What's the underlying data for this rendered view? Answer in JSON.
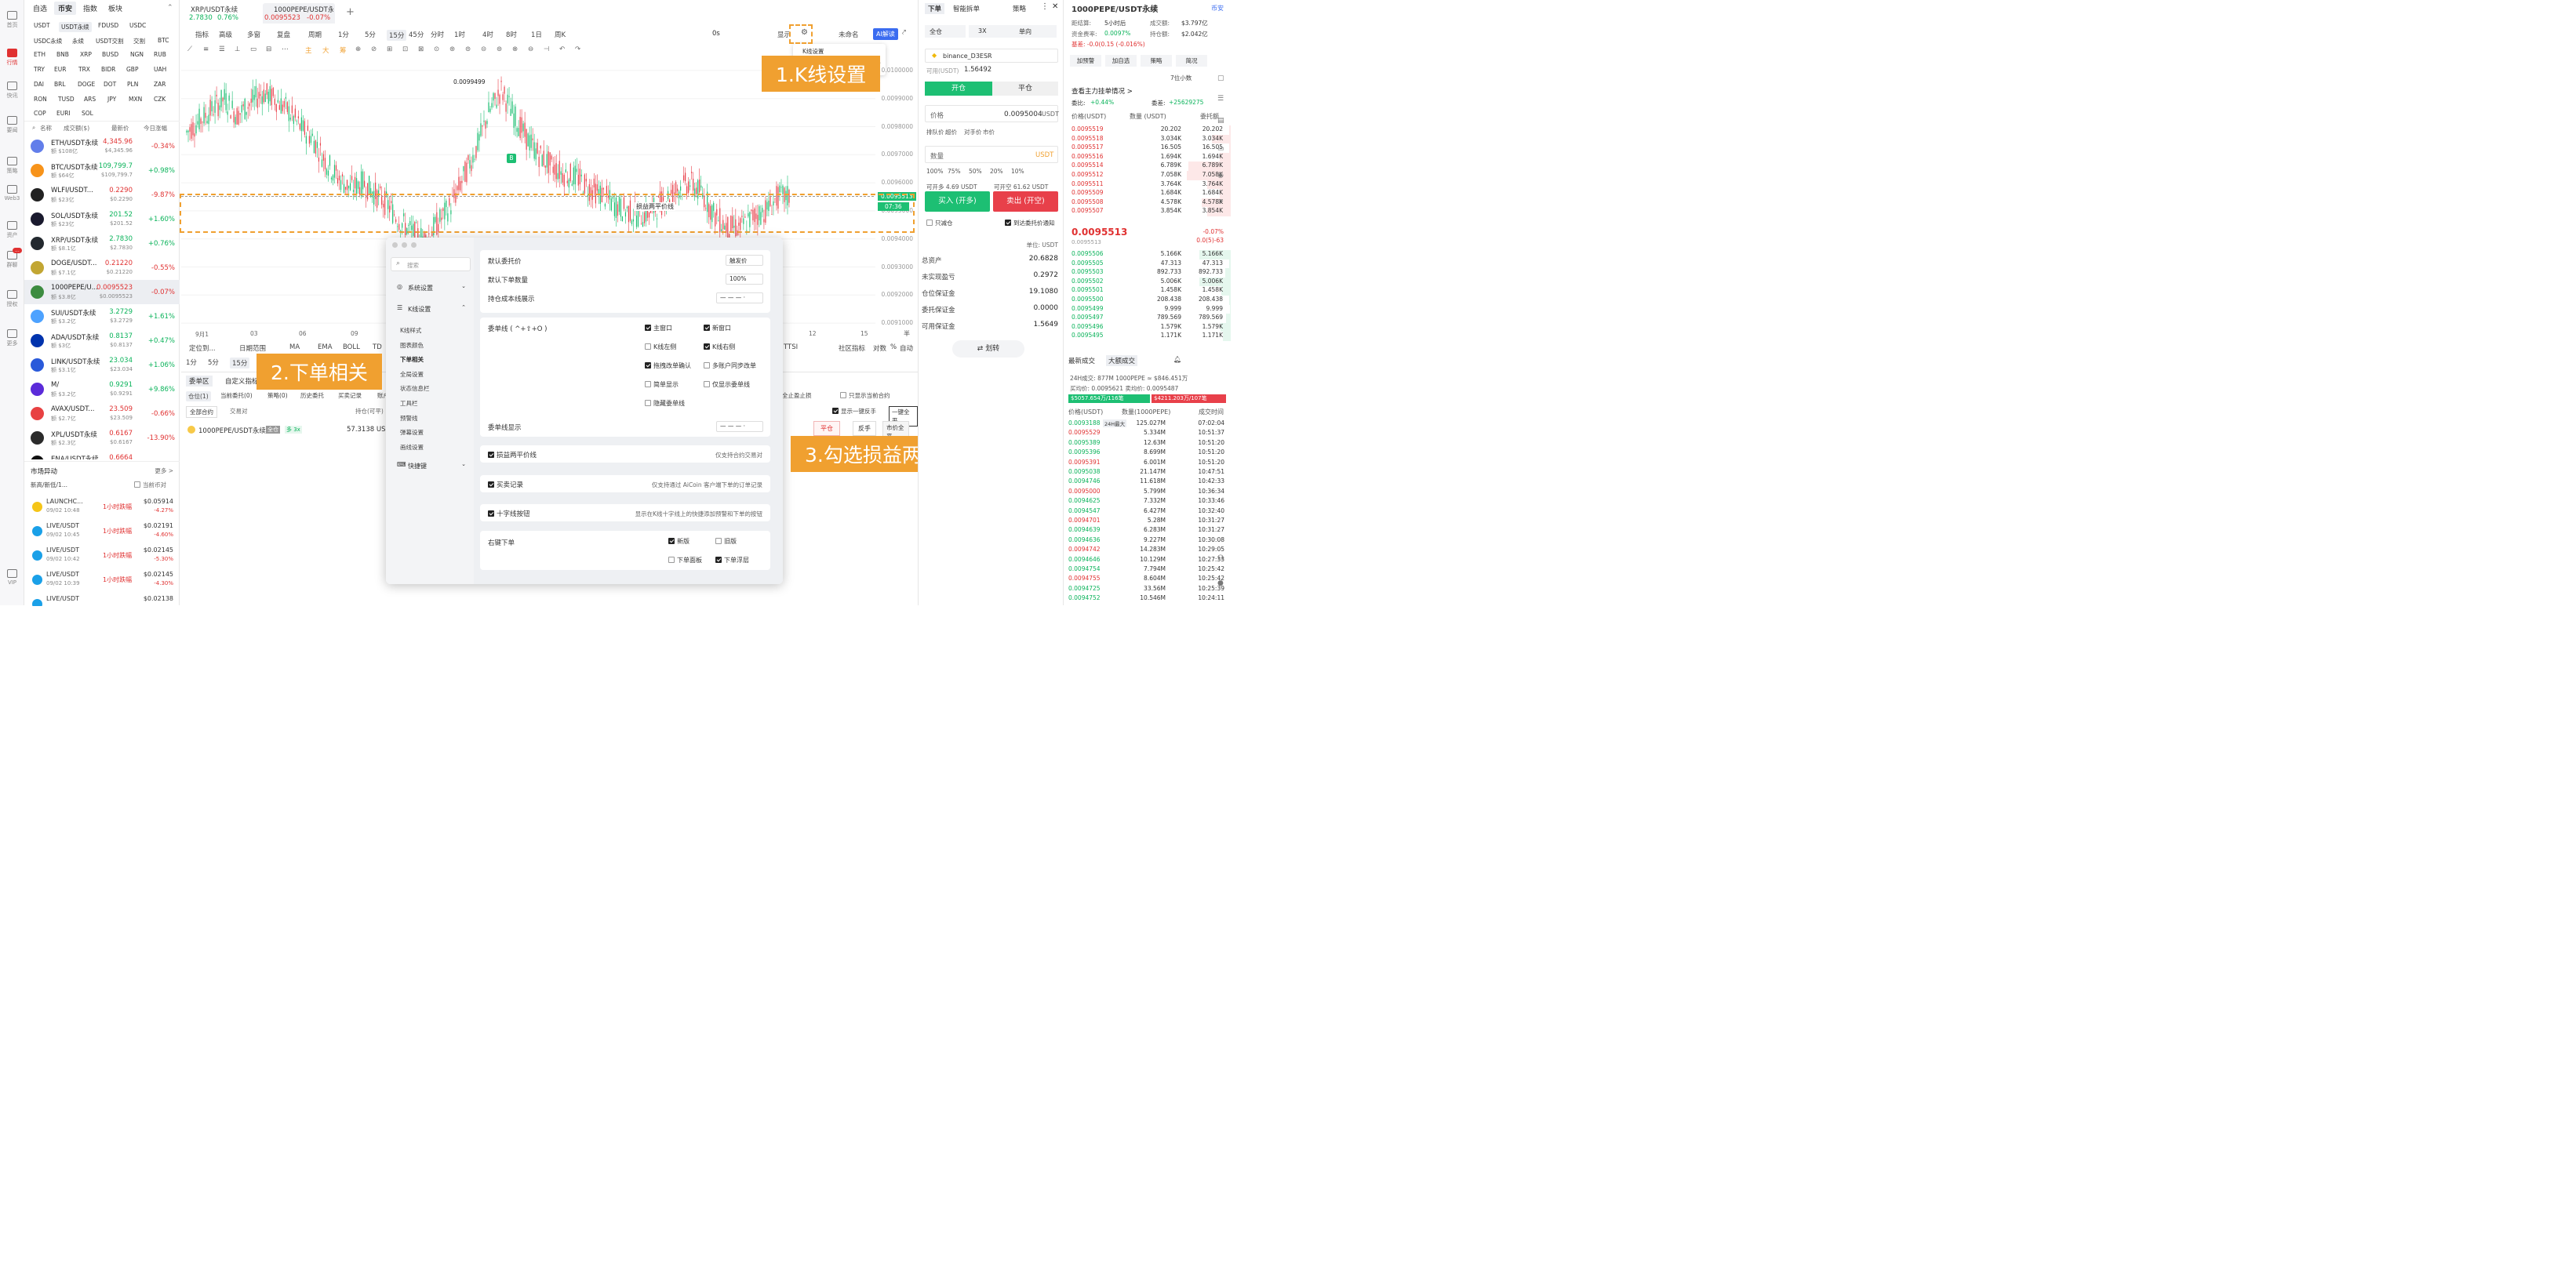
{
  "rail": [
    {
      "label": "首页",
      "icon": "home-icon"
    },
    {
      "label": "行情",
      "icon": "chart-icon",
      "active": true
    },
    {
      "label": "快讯",
      "icon": "news-icon"
    },
    {
      "label": "要闻",
      "icon": "doc-icon"
    },
    {
      "label": "策略",
      "icon": "strategy-icon"
    },
    {
      "label": "Web3",
      "icon": "web3-icon"
    },
    {
      "label": "资产",
      "icon": "asset-icon"
    },
    {
      "label": "群聊",
      "icon": "chat-icon",
      "badge": "..."
    },
    {
      "label": "授权",
      "icon": "auth-icon"
    },
    {
      "label": "更多",
      "icon": "more-icon"
    },
    {
      "label": "VIP",
      "icon": "vip-icon"
    }
  ],
  "market": {
    "tabs": [
      "自选",
      "币安",
      "指数",
      "板块"
    ],
    "currencies": [
      [
        "USDT",
        "USDT永续",
        "FDUSD",
        "USDC"
      ],
      [
        "USDC永续",
        "永续",
        "USDT交割",
        "交割",
        "BTC"
      ],
      [
        "ETH",
        "BNB",
        "XRP",
        "BUSD",
        "NGN",
        "RUB"
      ],
      [
        "TRY",
        "EUR",
        "TRX",
        "BIDR",
        "GBP",
        "UAH"
      ],
      [
        "DAI",
        "BRL",
        "DOGE",
        "DOT",
        "PLN",
        "ZAR"
      ],
      [
        "RON",
        "TUSD",
        "ARS",
        "JPY",
        "MXN",
        "CZK"
      ],
      [
        "COP",
        "EURI",
        "SOL"
      ]
    ],
    "headers": {
      "name": "名称",
      "vol": "成交额($)",
      "price": "最新价",
      "change": "今日涨幅"
    },
    "coins": [
      {
        "name": "ETH/USDT永续",
        "vol": "额 $108亿",
        "price": "4,345.96",
        "sub": "$4,345.96",
        "change": "-0.34%",
        "dir": "dn",
        "color": "#627eea"
      },
      {
        "name": "BTC/USDT永续",
        "vol": "额 $64亿",
        "price": "109,799.7",
        "sub": "$109,799.7",
        "change": "+0.98%",
        "dir": "up",
        "color": "#f7931a"
      },
      {
        "name": "WLFI/USDT...",
        "vol": "额 $23亿",
        "price": "0.2290",
        "sub": "$0.2290",
        "change": "-9.87%",
        "dir": "dn",
        "color": "#222222"
      },
      {
        "name": "SOL/USDT永续",
        "vol": "额 $23亿",
        "price": "201.52",
        "sub": "$201.52",
        "change": "+1.60%",
        "dir": "up",
        "color": "#1a1a2e"
      },
      {
        "name": "XRP/USDT永续",
        "vol": "额 $8.1亿",
        "price": "2.7830",
        "sub": "$2.7830",
        "change": "+0.76%",
        "dir": "up",
        "color": "#23292f"
      },
      {
        "name": "DOGE/USDT...",
        "vol": "额 $7.1亿",
        "price": "0.21220",
        "sub": "$0.21220",
        "change": "-0.55%",
        "dir": "dn",
        "color": "#c2a633"
      },
      {
        "name": "1000PEPE/U...",
        "vol": "额 $3.8亿",
        "price": "0.0095523",
        "sub": "$0.0095523",
        "change": "-0.07%",
        "dir": "dn",
        "color": "#3d8c40",
        "selected": true
      },
      {
        "name": "SUI/USDT永续",
        "vol": "额 $3.2亿",
        "price": "3.2729",
        "sub": "$3.2729",
        "change": "+1.61%",
        "dir": "up",
        "color": "#4da2ff"
      },
      {
        "name": "ADA/USDT永续",
        "vol": "额 $3亿",
        "price": "0.8137",
        "sub": "$0.8137",
        "change": "+0.47%",
        "dir": "up",
        "color": "#0033ad"
      },
      {
        "name": "LINK/USDT永续",
        "vol": "额 $3.1亿",
        "price": "23.034",
        "sub": "$23.034",
        "change": "+1.06%",
        "dir": "up",
        "color": "#2a5ada"
      },
      {
        "name": "M/",
        "vol": "额 $3.2亿",
        "price": "0.9291",
        "sub": "$0.9291",
        "change": "+9.86%",
        "dir": "up",
        "color": "#5b2bd9"
      },
      {
        "name": "AVAX/USDT...",
        "vol": "额 $2.7亿",
        "price": "23.509",
        "sub": "$23.509",
        "change": "-0.66%",
        "dir": "dn",
        "color": "#e84142"
      },
      {
        "name": "XPL/USDT永续",
        "vol": "额 $2.3亿",
        "price": "0.6167",
        "sub": "$0.6167",
        "change": "-13.90%",
        "dir": "dn",
        "color": "#2b2b2b"
      },
      {
        "name": "ENA/USDT永续",
        "vol": "",
        "price": "0.6664",
        "sub": "",
        "change": "",
        "dir": "dn",
        "color": "#111111"
      }
    ],
    "abnormal": {
      "title": "市场异动",
      "more": "更多 >",
      "filter": "新高/新低/1...",
      "current_only": "当前币对",
      "items": [
        {
          "name": "LAUNCHC...",
          "time": "09/02 10:48",
          "type": "1小时跌幅",
          "price": "$0.05914",
          "pct": "-4.27%",
          "color": "#f5c518"
        },
        {
          "name": "LIVE/USDT",
          "time": "09/02 10:45",
          "type": "1小时跌幅",
          "price": "$0.02191",
          "pct": "-4.60%",
          "color": "#1aa0e8"
        },
        {
          "name": "LIVE/USDT",
          "time": "09/02 10:42",
          "type": "1小时跌幅",
          "price": "$0.02145",
          "pct": "-5.30%",
          "color": "#1aa0e8"
        },
        {
          "name": "LIVE/USDT",
          "time": "09/02 10:39",
          "type": "1小时跌幅",
          "price": "$0.02145",
          "pct": "-4.30%",
          "color": "#1aa0e8"
        },
        {
          "name": "LIVE/USDT",
          "time": "",
          "type": "",
          "price": "$0.02138",
          "pct": "",
          "color": "#1aa0e8"
        }
      ]
    }
  },
  "chart": {
    "tabs": [
      {
        "title": "XRP/USDT永续",
        "price": "2.7830",
        "pct": "0.76%"
      },
      {
        "title": "1000PEPE/USDT永",
        "price": "0.0095523",
        "pct": "-0.07%"
      }
    ],
    "toolbar": [
      "指标",
      "高级",
      "多窗",
      "复盘",
      "周期",
      "1分",
      "5分",
      "15分",
      "45分",
      "分时",
      "1时",
      "4时",
      "8时",
      "1日",
      "周K"
    ],
    "toolbar_right": {
      "zero": "0s",
      "show": "显示",
      "unnamed": "未命名",
      "ai": "AI解读"
    },
    "draw_colors": [
      "主",
      "大",
      "筹"
    ],
    "popup": {
      "title": "K线设置",
      "hint": "时间、"
    },
    "high_label": "0.0099499",
    "price_ticks": [
      "0.0100000",
      "0.0099000",
      "0.0098000",
      "0.0097000",
      "0.0096000",
      "0.0095000",
      "0.0094000",
      "0.0093000",
      "0.0092000",
      "0.0091000"
    ],
    "time_ticks": [
      "9月1",
      "03",
      "06",
      "09",
      "12",
      "15"
    ],
    "pnl_line": "损益两平价线",
    "price_tag": "0.0095513",
    "countdown": "07:36",
    "bottom_toolbar": [
      "定位到...",
      "日期范围",
      "MA",
      "EMA",
      "BOLL",
      "TD"
    ],
    "bottom_right": [
      "TTSI",
      "社区指标",
      "对数",
      "%",
      "自动"
    ],
    "scale_right": [
      "半",
      "爆"
    ],
    "period_small": [
      "1分",
      "5分",
      "15分"
    ],
    "orders": {
      "tabs": [
        "委单区",
        "自定义指标"
      ],
      "subtabs": [
        "仓位(1)",
        "当前委托(0)",
        "策略(0)",
        "历史委托",
        "买卖记录",
        "账户"
      ],
      "filter": "全部合约",
      "type": "交易对",
      "col": "持仓(可平)",
      "row": {
        "name": "1000PEPE/USDT永续",
        "mode": "全仓",
        "lev": "多 3x",
        "qty": "57.3138 USDT"
      },
      "right": {
        "stop": "全止盈止损",
        "only_current": "只显示当前合约",
        "show_reverse": "显示一键反手",
        "close_all": "一键全平",
        "close": "平仓",
        "reverse": "反手",
        "market": "市价全平"
      }
    }
  },
  "chart_data": {
    "type": "candlestick",
    "ylim": [
      0.00905,
      0.01005
    ],
    "price_ticks": [
      0.01,
      0.0099,
      0.0098,
      0.0097,
      0.0096,
      0.0095,
      0.0094,
      0.0093,
      0.0092,
      0.0091
    ],
    "series_close": [
      0.00978,
      0.00982,
      0.00986,
      0.0099,
      0.00984,
      0.00988,
      0.00992,
      0.0099,
      0.00986,
      0.0098,
      0.00976,
      0.00968,
      0.00962,
      0.00958,
      0.0096,
      0.00956,
      0.00952,
      0.00946,
      0.00942,
      0.0094,
      0.00946,
      0.00952,
      0.00962,
      0.00972,
      0.00985,
      0.00993,
      0.00984,
      0.00976,
      0.0097,
      0.00966,
      0.00963,
      0.00962,
      0.00958,
      0.00956,
      0.00952,
      0.0095,
      0.00948,
      0.0095,
      0.00954,
      0.00958,
      0.0096,
      0.00956,
      0.00948,
      0.00944,
      0.00944,
      0.00948,
      0.0095,
      0.00955
    ],
    "high_marker": 0.0099499,
    "last": 0.0095513,
    "pnl_line": 0.0095513
  },
  "dialog": {
    "search": "搜索",
    "menu": [
      {
        "label": "系统设置",
        "icon": "gear-icon"
      },
      {
        "label": "K线设置",
        "icon": "kline-icon",
        "open": true
      }
    ],
    "submenu": [
      "K线样式",
      "图表颜色",
      "下单相关",
      "全局设置",
      "状态信息栏",
      "工具栏",
      "预警线",
      "弹幕设置",
      "画线设置"
    ],
    "shortcut": "快捷键",
    "default_price": {
      "label": "默认委托价",
      "value": "触发价"
    },
    "default_qty": {
      "label": "默认下单数量",
      "value": "100%"
    },
    "cost_line": {
      "label": "持仓成本线展示",
      "value": "— — — ·"
    },
    "order_line": {
      "label": "委单线 ( ^+⇧+O )",
      "opts": [
        {
          "t": "主窗口",
          "on": true
        },
        {
          "t": "新窗口",
          "on": true
        },
        {
          "t": "K线左侧",
          "on": false
        },
        {
          "t": "K线右侧",
          "on": true,
          "radio": true
        },
        {
          "t": "拖拽改单确认",
          "on": true
        },
        {
          "t": "多账户同步改单",
          "on": false
        },
        {
          "t": "简单显示",
          "on": false
        },
        {
          "t": "仅显示委单线",
          "on": false
        },
        {
          "t": "隐藏委单线",
          "on": false
        }
      ]
    },
    "order_line_show": {
      "label": "委单线显示",
      "value": "— — — ·"
    },
    "pnl": {
      "label": "损益两平价线",
      "note": "仅支持合约交易对",
      "on": true
    },
    "trades": {
      "label": "买卖记录",
      "note": "仅支持通过 AiCoin 客户端下单的订单记录",
      "on": true
    },
    "cross": {
      "label": "十字线按钮",
      "note": "显示在K线十字线上的快捷添加预警和下单的按钮",
      "on": true
    },
    "right_order": {
      "label": "右键下单",
      "opts": [
        {
          "t": "新版",
          "on": true
        },
        {
          "t": "旧版",
          "on": false
        },
        {
          "t": "下单面板",
          "on": false
        },
        {
          "t": "下单浮层",
          "on": true
        }
      ]
    }
  },
  "annotations": {
    "a1": "1.K线设置",
    "a2": "2.下单相关",
    "a3": "3.勾选损益两平价线"
  },
  "order_panel": {
    "tabs": [
      "下单",
      "智能拆单",
      "策略"
    ],
    "mode": [
      "全仓",
      "3X",
      "单向"
    ],
    "account": "binance_D3ESR",
    "available_label": "可用(USDT)",
    "available": "1.56492",
    "open": "开仓",
    "close": "平仓",
    "price_label": "价格",
    "price": "0.0095004",
    "unit": "USDT",
    "types": [
      "排队价",
      "超价",
      "对手价",
      "市价"
    ],
    "qty_label": "数量",
    "qty_unit": "USDT",
    "pcts": [
      "100%",
      "75%",
      "50%",
      "20%",
      "10%"
    ],
    "can_open": "可开多 4.69 USDT",
    "can_short": "可开空 61.62 USDT",
    "buy": "买入 (开多)",
    "sell": "卖出 (开空)",
    "reduce": "只减仓",
    "notify": "到达委托价通知",
    "unit_line": "单位: USDT",
    "stats": [
      {
        "k": "总资产",
        "v": "20.6828"
      },
      {
        "k": "未实现盈亏",
        "v": "0.2972",
        "up": true
      },
      {
        "k": "仓位保证金",
        "v": "19.1080"
      },
      {
        "k": "委托保证金",
        "v": "0.0000"
      },
      {
        "k": "可用保证金",
        "v": "1.5649"
      }
    ],
    "transfer": "划转"
  },
  "orderbook": {
    "title": "1000PEPE/USDT永续",
    "exchange": "币安",
    "info": [
      {
        "k": "距结算:",
        "v": "5小时后"
      },
      {
        "k": "成交额:",
        "v": "$3.797亿"
      },
      {
        "k": "资金费率:",
        "v": "0.0097%"
      },
      {
        "k": "持仓额:",
        "v": "$2.042亿"
      }
    ],
    "basis": "基差: -0.0(0.15 (-0.016%)",
    "btns": [
      "加预警",
      "加自选",
      "策略",
      "简况"
    ],
    "decimals": "7位小数",
    "main_title": "查看主力挂单情况 >",
    "ratio": {
      "k1": "委比:",
      "v1": "+0.44%",
      "k2": "委差:",
      "v2": "+25629275"
    },
    "cols": [
      "价格(USDT)",
      "数量 (USDT)",
      "委托额"
    ],
    "asks": [
      [
        "0.0095519",
        "20.202",
        "20.202"
      ],
      [
        "0.0095518",
        "3.034K",
        "3.034K"
      ],
      [
        "0.0095517",
        "16.505",
        "16.505"
      ],
      [
        "0.0095516",
        "1.694K",
        "1.694K"
      ],
      [
        "0.0095514",
        "6.789K",
        "6.789K"
      ],
      [
        "0.0095512",
        "7.058K",
        "7.058K"
      ],
      [
        "0.0095511",
        "3.764K",
        "3.764K"
      ],
      [
        "0.0095509",
        "1.684K",
        "1.684K"
      ],
      [
        "0.0095508",
        "4.578K",
        "4.578K"
      ],
      [
        "0.0095507",
        "3.854K",
        "3.854K"
      ]
    ],
    "ask_bars": [
      0.02,
      0.3,
      0.02,
      0.17,
      0.68,
      0.7,
      0.38,
      0.17,
      0.46,
      0.38
    ],
    "mid": "0.0095513",
    "mid_sub": "0.0095513",
    "mid_pct": "-0.07%",
    "mid_alt": "0.0(5)-63",
    "bids": [
      [
        "0.0095506",
        "5.166K",
        "5.166K"
      ],
      [
        "0.0095505",
        "47.313",
        "47.313"
      ],
      [
        "0.0095503",
        "892.733",
        "892.733"
      ],
      [
        "0.0095502",
        "5.006K",
        "5.006K"
      ],
      [
        "0.0095501",
        "1.458K",
        "1.458K"
      ],
      [
        "0.0095500",
        "208.438",
        "208.438"
      ],
      [
        "0.0095499",
        "9.999",
        "9.999"
      ],
      [
        "0.0095497",
        "789.569",
        "789.569"
      ],
      [
        "0.0095496",
        "1.579K",
        "1.579K"
      ],
      [
        "0.0095495",
        "1.171K",
        "1.171K"
      ]
    ],
    "bid_bars": [
      0.5,
      0.02,
      0.09,
      0.5,
      0.15,
      0.02,
      0.01,
      0.08,
      0.16,
      0.12
    ],
    "trades_tabs": [
      "最新成交",
      "大额成交"
    ],
    "vol24": "24H成交: 877M 1000PEPE ≈ $846.451万",
    "buysell": "买均价: 0.0095621  卖均价: 0.0095487",
    "buybar": "$5057.654万/116笔",
    "sellbar": "$4211.203万/107笔",
    "tcols": [
      "价格(USDT)",
      "数量(1000PEPE)",
      "成交时间"
    ],
    "trades": [
      [
        "0.0093188",
        "125.027M",
        "07:02:04",
        "24H最大"
      ],
      [
        "0.0095529",
        "5.334M",
        "10:51:37"
      ],
      [
        "0.0095389",
        "12.63M",
        "10:51:20"
      ],
      [
        "0.0095396",
        "8.699M",
        "10:51:20"
      ],
      [
        "0.0095391",
        "6.001M",
        "10:51:20"
      ],
      [
        "0.0095038",
        "21.147M",
        "10:47:51"
      ],
      [
        "0.0094746",
        "11.618M",
        "10:42:33"
      ],
      [
        "0.0095000",
        "5.799M",
        "10:36:34"
      ],
      [
        "0.0094625",
        "7.332M",
        "10:33:46"
      ],
      [
        "0.0094547",
        "6.427M",
        "10:32:40"
      ],
      [
        "0.0094701",
        "5.28M",
        "10:31:27"
      ],
      [
        "0.0094639",
        "6.283M",
        "10:31:27"
      ],
      [
        "0.0094636",
        "9.227M",
        "10:30:08"
      ],
      [
        "0.0094742",
        "14.283M",
        "10:29:05"
      ],
      [
        "0.0094646",
        "10.129M",
        "10:27:33"
      ],
      [
        "0.0094754",
        "7.794M",
        "10:25:42"
      ],
      [
        "0.0094755",
        "8.604M",
        "10:25:42"
      ],
      [
        "0.0094725",
        "33.56M",
        "10:25:39"
      ],
      [
        "0.0094752",
        "10.546M",
        "10:24:11"
      ]
    ]
  }
}
